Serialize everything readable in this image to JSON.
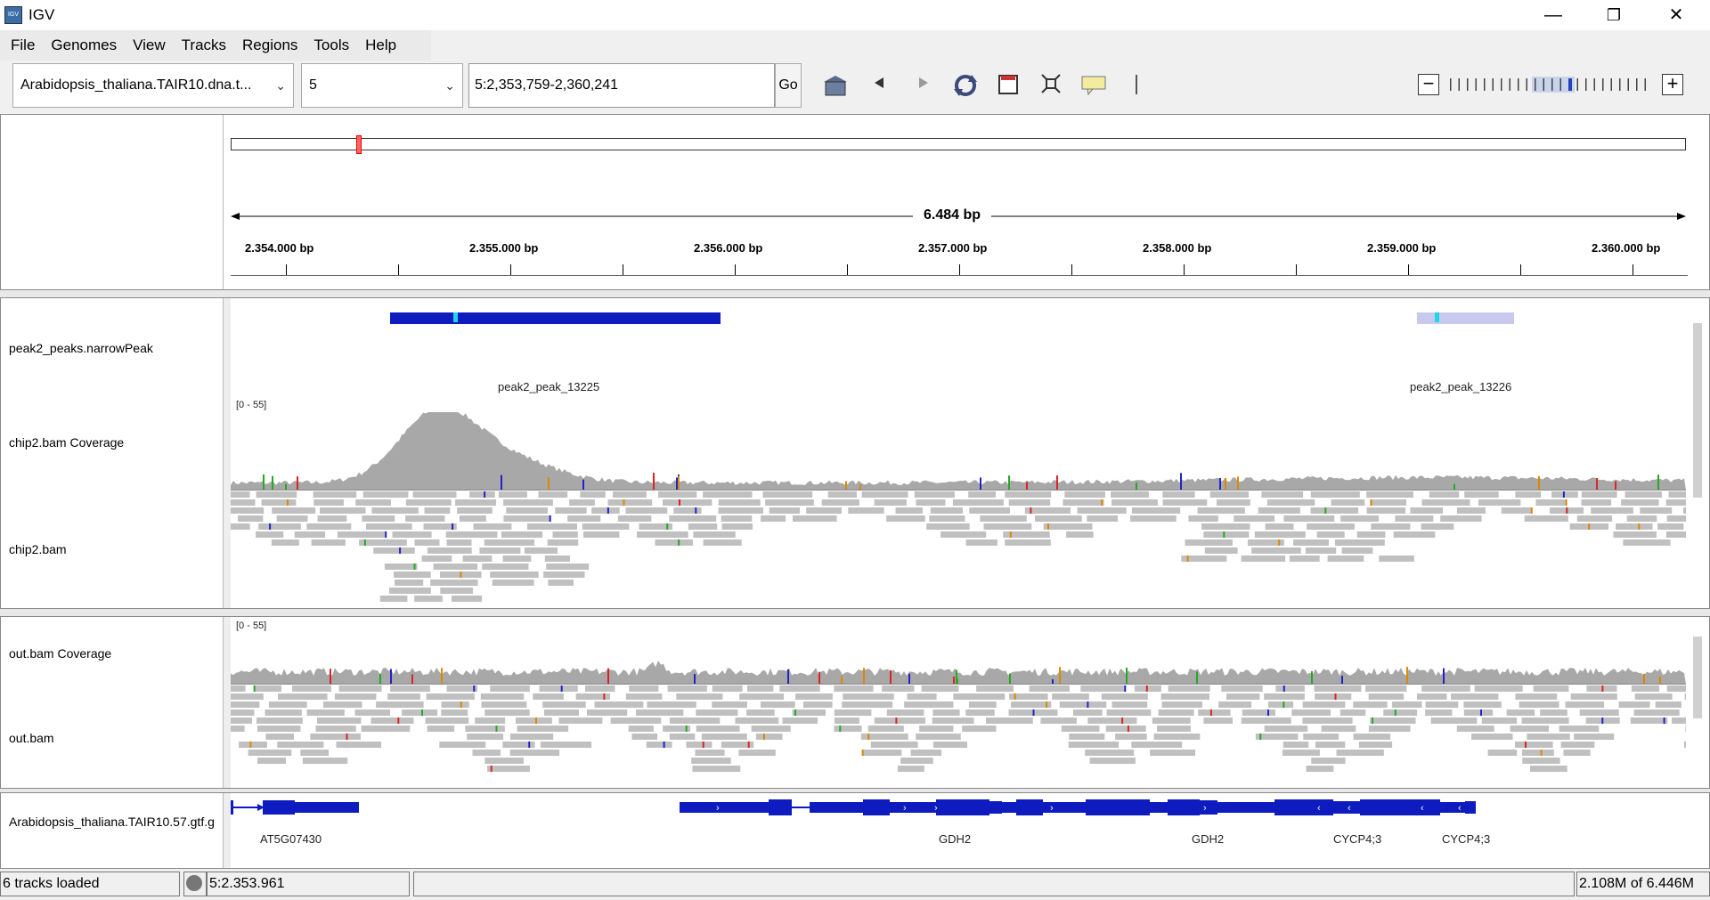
{
  "window": {
    "title": "IGV",
    "icon": "igv-app-icon",
    "min_glyph": "—",
    "max_glyph": "❐",
    "close_glyph": "✕"
  },
  "menu": [
    "File",
    "Genomes",
    "View",
    "Tracks",
    "Regions",
    "Tools",
    "Help"
  ],
  "toolbar": {
    "genome": "Arabidopsis_thaliana.TAIR10.dna.t...",
    "chromosome": "5",
    "locus": "5:2,353,759-2,360,241",
    "go_label": "Go",
    "icons": [
      "home-icon",
      "back-arrow-icon",
      "forward-arrow-icon",
      "refresh-icon",
      "roi-icon",
      "resize-icon",
      "popup-text-icon",
      "ruler-toggle-icon"
    ],
    "zoom_minus": "−",
    "zoom_plus": "+",
    "zoom_level": 0.63
  },
  "ruler": {
    "span_label": "6.484 bp",
    "ticks": [
      "2.354.000 bp",
      "2.355.000 bp",
      "2.356.000 bp",
      "2.357.000 bp",
      "2.358.000 bp",
      "2.359.000 bp",
      "2.360.000 bp"
    ]
  },
  "tracks": {
    "peaks": {
      "name": "peak2_peaks.narrowPeak",
      "features": [
        "peak2_peak_13225",
        "peak2_peak_13226"
      ]
    },
    "chip_cov": {
      "name": "chip2.bam Coverage",
      "range": "[0 - 55]"
    },
    "chip_bam": {
      "name": "chip2.bam"
    },
    "out_cov": {
      "name": "out.bam Coverage",
      "range": "[0 - 55]"
    },
    "out_bam": {
      "name": "out.bam"
    },
    "gtf": {
      "name": "Arabidopsis_thaliana.TAIR10.57.gtf.g",
      "genes": [
        "AT5G07430",
        "GDH2",
        "GDH2",
        "CYCP4;3",
        "CYCP4;3"
      ]
    }
  },
  "status": {
    "tracks_loaded": "6 tracks loaded",
    "position": "5:2.353.961",
    "memory": "2.108M of 6.446M"
  },
  "colors": {
    "feature_blue": "#0d1bbf",
    "peak_light": "#c9c9f0",
    "coverage_gray": "#a8a8a8",
    "read_gray": "#c0c0c0"
  }
}
